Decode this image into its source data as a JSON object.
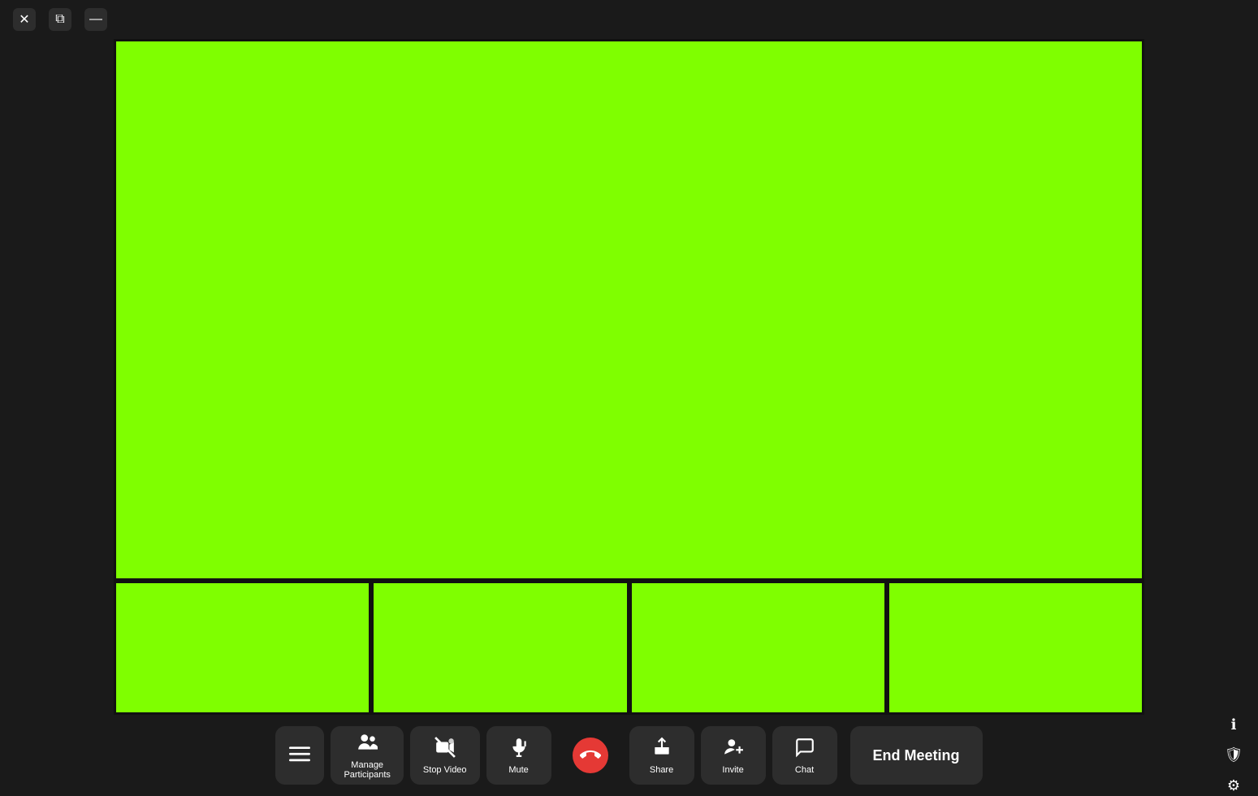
{
  "titlebar": {
    "close_label": "✕",
    "tile_label": "⧉",
    "minimize_label": "—"
  },
  "toolbar": {
    "menu_icon": "☰",
    "manage_participants_label": "Manage\nParticipants",
    "stop_video_label": "Stop Video",
    "mute_label": "Mute",
    "end_call_label": "",
    "share_label": "Share",
    "invite_label": "Invite",
    "chat_label": "Chat",
    "end_meeting_label": "End Meeting"
  },
  "video": {
    "main_color": "#7fff00",
    "thumb_color": "#7fff00",
    "thumbnails_count": 4
  },
  "side_icons": {
    "info": "ℹ",
    "shield": "🛡",
    "gear": "⚙"
  }
}
